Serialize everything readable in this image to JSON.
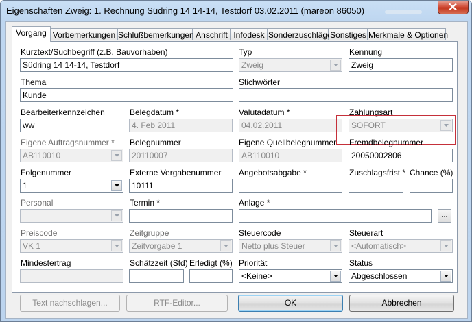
{
  "window": {
    "title": "Eigenschaften Zweig: 1. Rechnung Südring 14 14-14, Testdorf 03.02.2011 (mareon 86050)"
  },
  "tabs": [
    "Vorgang",
    "Vorbemerkungen",
    "Schlußbemerkungen",
    "Anschrift",
    "Infodesk",
    "Sonderzuschläge",
    "Sonstiges",
    "Merkmale & Optionen"
  ],
  "fields": {
    "kurztext": {
      "label": "Kurztext/Suchbegriff (z.B. Bauvorhaben)",
      "value": "Südring 14 14-14, Testdorf"
    },
    "typ": {
      "label": "Typ",
      "value": "Zweig"
    },
    "kennung": {
      "label": "Kennung",
      "value": "Zweig"
    },
    "thema": {
      "label": "Thema",
      "value": "Kunde"
    },
    "stichwoerter": {
      "label": "Stichwörter",
      "value": ""
    },
    "bearbeiter": {
      "label": "Bearbeiterkennzeichen",
      "value": "ww"
    },
    "belegdatum": {
      "label": "Belegdatum *",
      "value": "4. Feb 2011"
    },
    "valutadatum": {
      "label": "Valutadatum *",
      "value": "04.02.2011"
    },
    "zahlungsart": {
      "label": "Zahlungsart",
      "value": "SOFORT"
    },
    "auftragsnummer": {
      "label": "Eigene Auftragsnummer *",
      "value": "AB110010"
    },
    "belegnummer": {
      "label": "Belegnummer",
      "value": "20110007"
    },
    "quellbeleg": {
      "label": "Eigene Quellbelegnummer",
      "value": "AB110010"
    },
    "fremdbeleg": {
      "label": "Fremdbelegnummer",
      "value": "20050002806"
    },
    "folgenummer": {
      "label": "Folgenummer",
      "value": "1"
    },
    "vergabenummer": {
      "label": "Externe Vergabenummer",
      "value": "10111"
    },
    "angebotsabgabe": {
      "label": "Angebotsabgabe *",
      "value": ""
    },
    "zuschlagsfrist": {
      "label": "Zuschlagsfrist *",
      "value": ""
    },
    "chance": {
      "label": "Chance (%)",
      "value": ""
    },
    "personal": {
      "label": "Personal",
      "value": ""
    },
    "termin": {
      "label": "Termin *",
      "value": ""
    },
    "anlage": {
      "label": "Anlage *",
      "value": "",
      "browse": "..."
    },
    "preiscode": {
      "label": "Preiscode",
      "value": "VK 1"
    },
    "zeitgruppe": {
      "label": "Zeitgruppe",
      "value": "Zeitvorgabe 1"
    },
    "steuercode": {
      "label": "Steuercode",
      "value": "Netto plus Steuer"
    },
    "steuerart": {
      "label": "Steuerart",
      "value": "<Automatisch>"
    },
    "mindestertrag": {
      "label": "Mindestertrag",
      "value": ""
    },
    "schaetzzeit": {
      "label": "Schätzzeit (Std)",
      "value": ""
    },
    "erledigt": {
      "label": "Erledigt (%)",
      "value": ""
    },
    "prioritaet": {
      "label": "Priorität",
      "value": "<Keine>"
    },
    "status": {
      "label": "Status",
      "value": "Abgeschlossen"
    }
  },
  "buttons": {
    "text_lookup": "Text nachschlagen...",
    "rtf": "RTF-Editor...",
    "ok": "OK",
    "cancel": "Abbrechen"
  },
  "colors": {
    "highlight_border": "#c5303a",
    "window_frame": "#bcd4ee"
  }
}
